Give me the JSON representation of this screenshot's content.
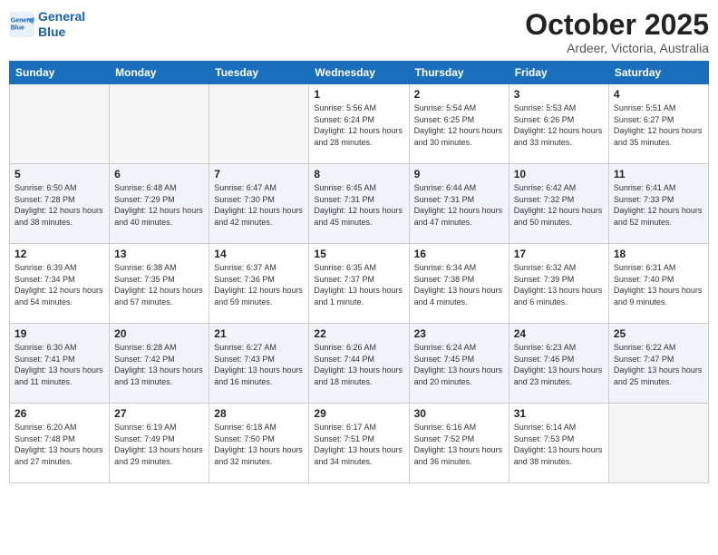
{
  "header": {
    "logo_line1": "General",
    "logo_line2": "Blue",
    "month": "October 2025",
    "location": "Ardeer, Victoria, Australia"
  },
  "weekdays": [
    "Sunday",
    "Monday",
    "Tuesday",
    "Wednesday",
    "Thursday",
    "Friday",
    "Saturday"
  ],
  "weeks": [
    [
      {
        "day": "",
        "empty": true
      },
      {
        "day": "",
        "empty": true
      },
      {
        "day": "",
        "empty": true
      },
      {
        "day": "1",
        "sunrise": "5:56 AM",
        "sunset": "6:24 PM",
        "daylight": "12 hours and 28 minutes."
      },
      {
        "day": "2",
        "sunrise": "5:54 AM",
        "sunset": "6:25 PM",
        "daylight": "12 hours and 30 minutes."
      },
      {
        "day": "3",
        "sunrise": "5:53 AM",
        "sunset": "6:26 PM",
        "daylight": "12 hours and 33 minutes."
      },
      {
        "day": "4",
        "sunrise": "5:51 AM",
        "sunset": "6:27 PM",
        "daylight": "12 hours and 35 minutes."
      }
    ],
    [
      {
        "day": "5",
        "sunrise": "6:50 AM",
        "sunset": "7:28 PM",
        "daylight": "12 hours and 38 minutes."
      },
      {
        "day": "6",
        "sunrise": "6:48 AM",
        "sunset": "7:29 PM",
        "daylight": "12 hours and 40 minutes."
      },
      {
        "day": "7",
        "sunrise": "6:47 AM",
        "sunset": "7:30 PM",
        "daylight": "12 hours and 42 minutes."
      },
      {
        "day": "8",
        "sunrise": "6:45 AM",
        "sunset": "7:31 PM",
        "daylight": "12 hours and 45 minutes."
      },
      {
        "day": "9",
        "sunrise": "6:44 AM",
        "sunset": "7:31 PM",
        "daylight": "12 hours and 47 minutes."
      },
      {
        "day": "10",
        "sunrise": "6:42 AM",
        "sunset": "7:32 PM",
        "daylight": "12 hours and 50 minutes."
      },
      {
        "day": "11",
        "sunrise": "6:41 AM",
        "sunset": "7:33 PM",
        "daylight": "12 hours and 52 minutes."
      }
    ],
    [
      {
        "day": "12",
        "sunrise": "6:39 AM",
        "sunset": "7:34 PM",
        "daylight": "12 hours and 54 minutes."
      },
      {
        "day": "13",
        "sunrise": "6:38 AM",
        "sunset": "7:35 PM",
        "daylight": "12 hours and 57 minutes."
      },
      {
        "day": "14",
        "sunrise": "6:37 AM",
        "sunset": "7:36 PM",
        "daylight": "12 hours and 59 minutes."
      },
      {
        "day": "15",
        "sunrise": "6:35 AM",
        "sunset": "7:37 PM",
        "daylight": "13 hours and 1 minute."
      },
      {
        "day": "16",
        "sunrise": "6:34 AM",
        "sunset": "7:38 PM",
        "daylight": "13 hours and 4 minutes."
      },
      {
        "day": "17",
        "sunrise": "6:32 AM",
        "sunset": "7:39 PM",
        "daylight": "13 hours and 6 minutes."
      },
      {
        "day": "18",
        "sunrise": "6:31 AM",
        "sunset": "7:40 PM",
        "daylight": "13 hours and 9 minutes."
      }
    ],
    [
      {
        "day": "19",
        "sunrise": "6:30 AM",
        "sunset": "7:41 PM",
        "daylight": "13 hours and 11 minutes."
      },
      {
        "day": "20",
        "sunrise": "6:28 AM",
        "sunset": "7:42 PM",
        "daylight": "13 hours and 13 minutes."
      },
      {
        "day": "21",
        "sunrise": "6:27 AM",
        "sunset": "7:43 PM",
        "daylight": "13 hours and 16 minutes."
      },
      {
        "day": "22",
        "sunrise": "6:26 AM",
        "sunset": "7:44 PM",
        "daylight": "13 hours and 18 minutes."
      },
      {
        "day": "23",
        "sunrise": "6:24 AM",
        "sunset": "7:45 PM",
        "daylight": "13 hours and 20 minutes."
      },
      {
        "day": "24",
        "sunrise": "6:23 AM",
        "sunset": "7:46 PM",
        "daylight": "13 hours and 23 minutes."
      },
      {
        "day": "25",
        "sunrise": "6:22 AM",
        "sunset": "7:47 PM",
        "daylight": "13 hours and 25 minutes."
      }
    ],
    [
      {
        "day": "26",
        "sunrise": "6:20 AM",
        "sunset": "7:48 PM",
        "daylight": "13 hours and 27 minutes."
      },
      {
        "day": "27",
        "sunrise": "6:19 AM",
        "sunset": "7:49 PM",
        "daylight": "13 hours and 29 minutes."
      },
      {
        "day": "28",
        "sunrise": "6:18 AM",
        "sunset": "7:50 PM",
        "daylight": "13 hours and 32 minutes."
      },
      {
        "day": "29",
        "sunrise": "6:17 AM",
        "sunset": "7:51 PM",
        "daylight": "13 hours and 34 minutes."
      },
      {
        "day": "30",
        "sunrise": "6:16 AM",
        "sunset": "7:52 PM",
        "daylight": "13 hours and 36 minutes."
      },
      {
        "day": "31",
        "sunrise": "6:14 AM",
        "sunset": "7:53 PM",
        "daylight": "13 hours and 38 minutes."
      },
      {
        "day": "",
        "empty": true
      }
    ]
  ],
  "labels": {
    "sunrise": "Sunrise:",
    "sunset": "Sunset:",
    "daylight": "Daylight:"
  }
}
